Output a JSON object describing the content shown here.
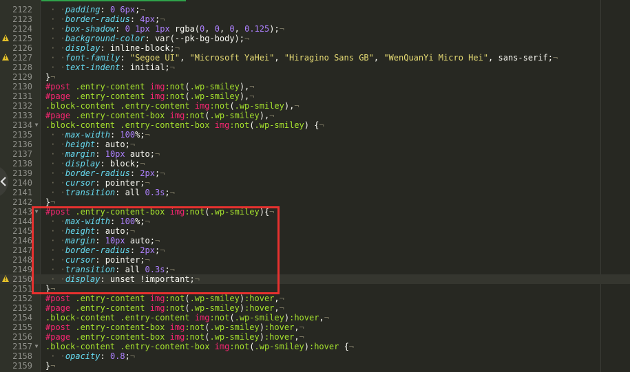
{
  "editor": {
    "lines": [
      {
        "n": "2122",
        "t": "    padding: 0 6px;¬"
      },
      {
        "n": "2123",
        "t": "    border-radius: 4px;¬"
      },
      {
        "n": "2124",
        "t": "    box-shadow: 0 1px 1px rgba(0, 0, 0, 0.125);¬"
      },
      {
        "n": "2125",
        "t": "    background-color: var(--pk-bg-body);¬",
        "warn": true
      },
      {
        "n": "2126",
        "t": "    display: inline-block;¬"
      },
      {
        "n": "2127",
        "t": "    font-family: \"Segoe UI\", \"Microsoft YaHei\", \"Hiragino Sans GB\", \"WenQuanYi Micro Hei\", sans-serif;¬",
        "warn": true
      },
      {
        "n": "2128",
        "t": "    text-indent: initial;¬"
      },
      {
        "n": "2129",
        "t": "}¬"
      },
      {
        "n": "2130",
        "t": "#post .entry-content img:not(.wp-smiley),¬"
      },
      {
        "n": "2131",
        "t": "#page .entry-content img:not(.wp-smiley),¬"
      },
      {
        "n": "2132",
        "t": ".block-content .entry-content img:not(.wp-smiley),¬"
      },
      {
        "n": "2133",
        "t": "#page .entry-content-box img:not(.wp-smiley),¬"
      },
      {
        "n": "2134",
        "t": ".block-content .entry-content-box img:not(.wp-smiley) {¬",
        "fold": true
      },
      {
        "n": "2135",
        "t": "    max-width: 100%;¬"
      },
      {
        "n": "2136",
        "t": "    height: auto;¬"
      },
      {
        "n": "2137",
        "t": "    margin: 10px auto;¬"
      },
      {
        "n": "2138",
        "t": "    display: block;¬"
      },
      {
        "n": "2139",
        "t": "    border-radius: 2px;¬"
      },
      {
        "n": "2140",
        "t": "    cursor: pointer;¬"
      },
      {
        "n": "2141",
        "t": "    transition: all 0.3s;¬"
      },
      {
        "n": "2142",
        "t": "}¬"
      },
      {
        "n": "2143",
        "t": "#post .entry-content-box img:not(.wp-smiley){¬",
        "fold": true
      },
      {
        "n": "2144",
        "t": "    max-width: 100%;¬"
      },
      {
        "n": "2145",
        "t": "    height: auto;¬"
      },
      {
        "n": "2146",
        "t": "    margin: 10px auto;¬"
      },
      {
        "n": "2147",
        "t": "    border-radius: 2px;¬"
      },
      {
        "n": "2148",
        "t": "    cursor: pointer;¬"
      },
      {
        "n": "2149",
        "t": "    transition: all 0.3s;¬"
      },
      {
        "n": "2150",
        "t": "    display: unset !important;¬",
        "warn": true,
        "active": true
      },
      {
        "n": "2151",
        "t": "}¬"
      },
      {
        "n": "2152",
        "t": "#post .entry-content img:not(.wp-smiley):hover,¬"
      },
      {
        "n": "2153",
        "t": "#page .entry-content img:not(.wp-smiley):hover,¬"
      },
      {
        "n": "2154",
        "t": ".block-content .entry-content img:not(.wp-smiley):hover,¬"
      },
      {
        "n": "2155",
        "t": "#post .entry-content-box img:not(.wp-smiley):hover,¬"
      },
      {
        "n": "2156",
        "t": "#page .entry-content-box img:not(.wp-smiley):hover,¬"
      },
      {
        "n": "2157",
        "t": ".block-content .entry-content-box img:not(.wp-smiley):hover {¬",
        "fold": true
      },
      {
        "n": "2158",
        "t": "    opacity: 0.8;¬"
      },
      {
        "n": "2159",
        "t": "}¬"
      }
    ]
  },
  "icons": {
    "warning": "warning-icon",
    "fold": "fold-arrow-icon",
    "nav": "chevron-left-icon"
  },
  "colors": {
    "background": "#272822",
    "highlight_border": "#e8312f",
    "property": "#66d9ef",
    "number": "#ae81ff",
    "string": "#e6db74",
    "id_selector": "#f92672",
    "class_selector": "#a6e22e"
  }
}
